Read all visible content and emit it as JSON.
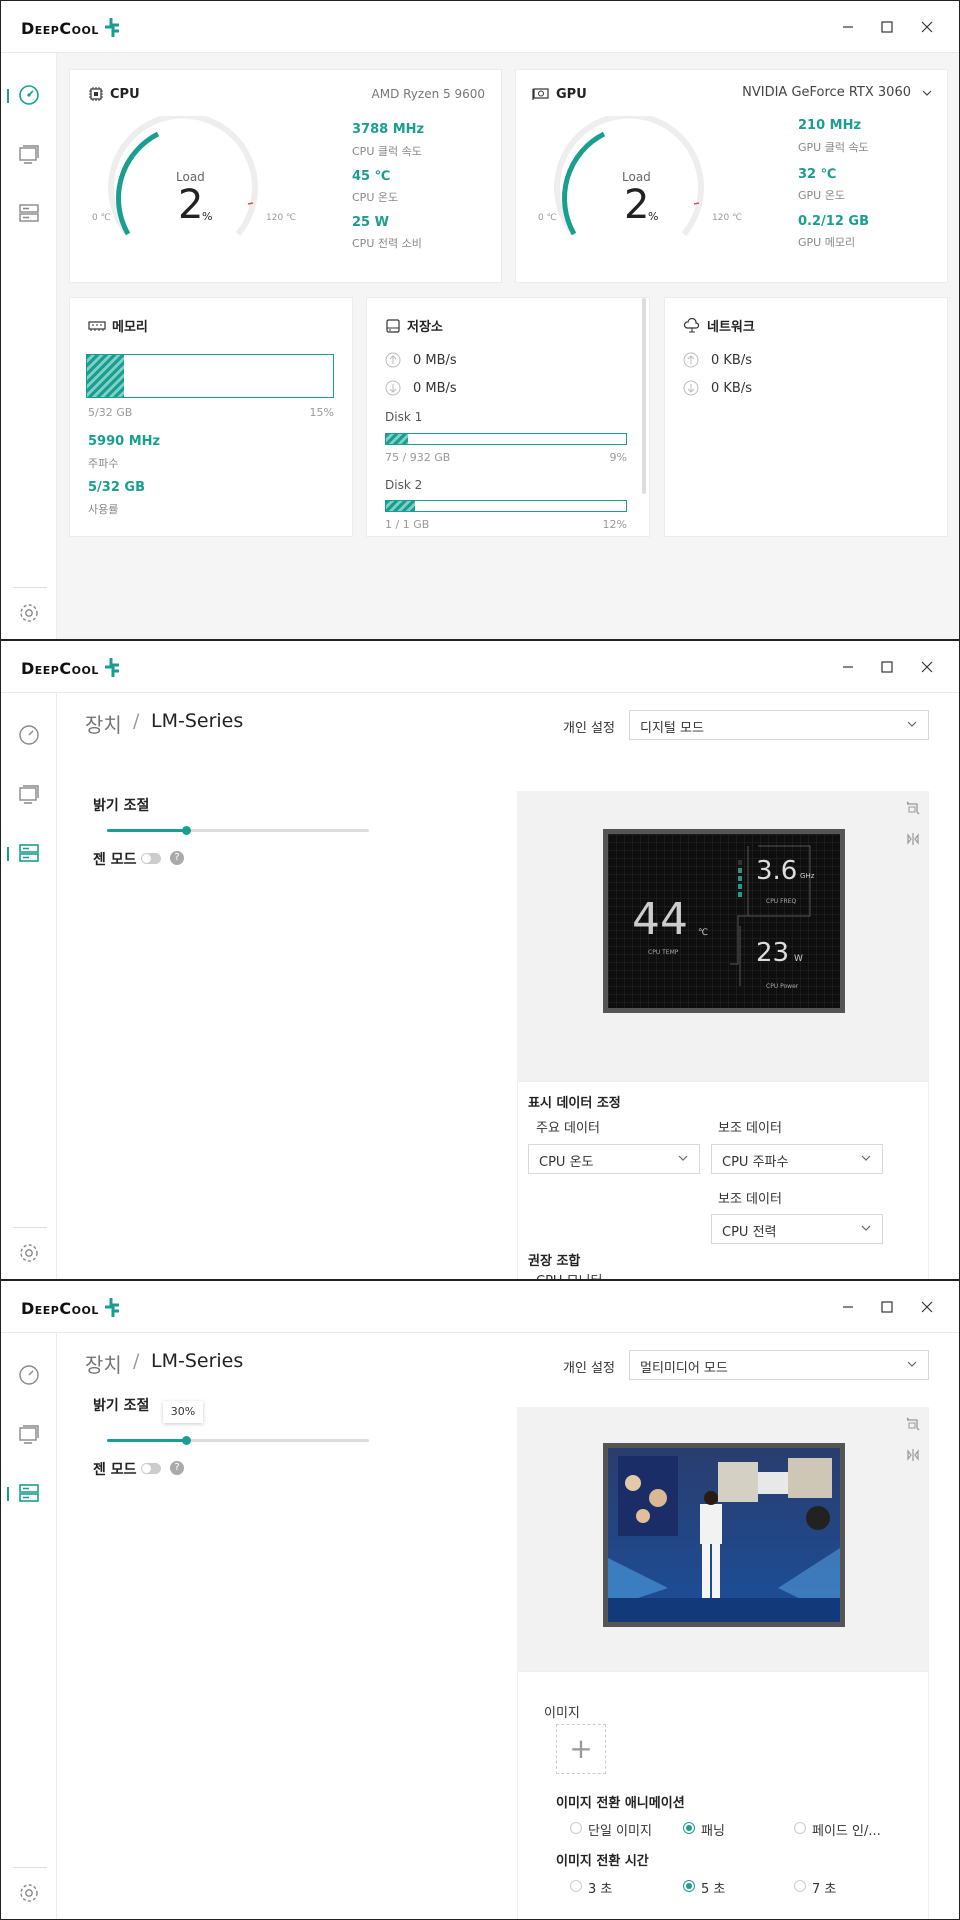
{
  "brand": {
    "logo_text": "DeepCool",
    "accent": "#1a9e8f"
  },
  "window1": {
    "cpu": {
      "title": "CPU",
      "model": "AMD Ryzen 5 9600",
      "gauge_load_label": "Load",
      "gauge_value": "2",
      "gauge_unit": "%",
      "gauge_min": "0 ℃",
      "gauge_max": "120 ℃",
      "clock_value": "3788 MHz",
      "clock_label": "CPU 클럭 속도",
      "temp_value": "45 ℃",
      "temp_label": "CPU 온도",
      "power_value": "25 W",
      "power_label": "CPU 전력 소비"
    },
    "gpu": {
      "title": "GPU",
      "model": "NVIDIA GeForce RTX 3060",
      "gauge_load_label": "Load",
      "gauge_value": "2",
      "gauge_unit": "%",
      "gauge_min": "0 ℃",
      "gauge_max": "120 ℃",
      "clock_value": "210 MHz",
      "clock_label": "GPU 클럭 속도",
      "temp_value": "32 ℃",
      "temp_label": "GPU 온도",
      "mem_value": "0.2/12 GB",
      "mem_label": "GPU 메모리"
    },
    "memory": {
      "title": "메모리",
      "usage_fraction": 0.15,
      "used_text": "5/32 GB",
      "percent_text": "15%",
      "freq_value": "5990 MHz",
      "freq_label": "주파수",
      "usage_value": "5/32 GB",
      "usage_label": "사용률"
    },
    "storage": {
      "title": "저장소",
      "upload": "0 MB/s",
      "download": "0 MB/s",
      "disk1_name": "Disk 1",
      "disk1_fraction": 0.09,
      "disk1_size": "75 / 932 GB",
      "disk1_percent": "9%",
      "disk2_name": "Disk 2",
      "disk2_fraction": 0.12,
      "disk2_size": "1 / 1 GB",
      "disk2_percent": "12%"
    },
    "network": {
      "title": "네트워크",
      "upload": "0 KB/s",
      "download": "0 KB/s"
    }
  },
  "window2": {
    "breadcrumb_root": "장치",
    "breadcrumb_sep": "/",
    "breadcrumb_device": "LM-Series",
    "personal_label": "개인 설정",
    "mode_value": "디지털 모드",
    "brightness_label": "밝기 조절",
    "brightness_fraction": 0.3,
    "zen_label": "젠 모드",
    "help_glyph": "?",
    "preview": {
      "freq_value": "3.6",
      "freq_unit": "GHz",
      "freq_label": "CPU FREQ",
      "temp_value": "44",
      "temp_unit": "℃",
      "temp_label": "CPU TEMP",
      "power_value": "23",
      "power_unit": "W",
      "power_label": "CPU Power"
    },
    "display_section": "표시 데이터 조정",
    "primary_label": "주요 데이터",
    "primary_value": "CPU 온도",
    "secondary_label": "보조 데이터",
    "secondary_value": "CPU 주파수",
    "secondary2_label": "보조 데이터",
    "secondary2_value": "CPU 전력",
    "recommend_label": "권장 조합",
    "recommend_item": "CPU 모니터"
  },
  "window3": {
    "breadcrumb_root": "장치",
    "breadcrumb_sep": "/",
    "breadcrumb_device": "LM-Series",
    "personal_label": "개인 설정",
    "mode_value": "멀티미디어 모드",
    "brightness_label": "밝기 조절",
    "brightness_fraction": 0.3,
    "brightness_tooltip": "30%",
    "zen_label": "젠 모드",
    "help_glyph": "?",
    "image_label": "이미지",
    "add_glyph": "+",
    "anim_label": "이미지 전환 애니메이션",
    "anim_options": [
      "단일 이미지",
      "패닝",
      "페이드 인/..."
    ],
    "anim_selected": 1,
    "time_label": "이미지 전환 시간",
    "time_options": [
      "3 초",
      "5 초",
      "7 초"
    ],
    "time_selected": 1
  }
}
